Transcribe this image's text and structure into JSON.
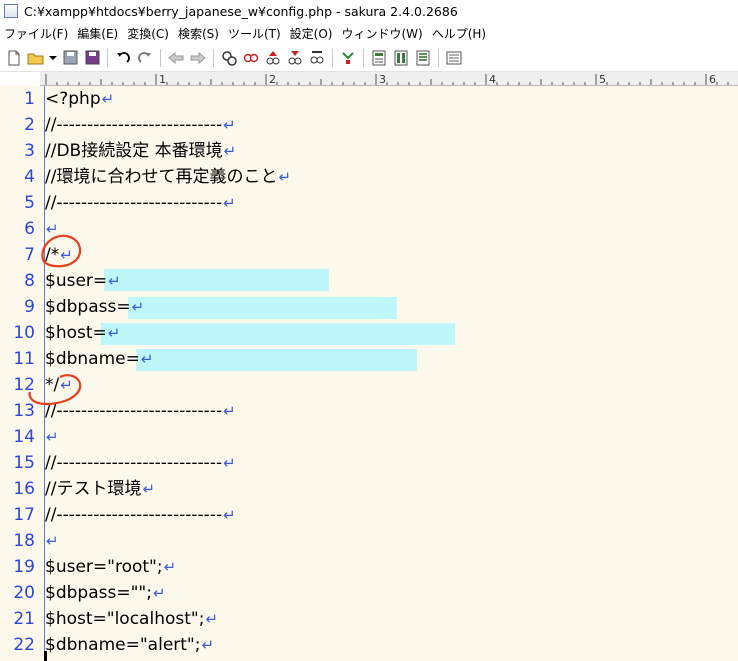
{
  "window": {
    "title": "C:¥xampp¥htdocs¥berry_japanese_w¥config.php - sakura 2.4.0.2686"
  },
  "menu": [
    "ファイル(F)",
    "編集(E)",
    "変換(C)",
    "検索(S)",
    "ツール(T)",
    "設定(O)",
    "ウィンドウ(W)",
    "ヘルプ(H)"
  ],
  "ruler": {
    "labels": [
      "1",
      "2",
      "3",
      "4",
      "5",
      "6"
    ]
  },
  "newline_glyph": "↵",
  "lines": [
    {
      "n": "1",
      "text": "<?php"
    },
    {
      "n": "2",
      "text": "//---------------------------"
    },
    {
      "n": "3",
      "text": "//DB接続設定 本番環境"
    },
    {
      "n": "4",
      "text": "//環境に合わせて再定義のこと"
    },
    {
      "n": "5",
      "text": "//---------------------------"
    },
    {
      "n": "6",
      "text": ""
    },
    {
      "n": "7",
      "text": "/*"
    },
    {
      "n": "8",
      "text": "$user="
    },
    {
      "n": "9",
      "text": "$dbpass="
    },
    {
      "n": "10",
      "text": "$host="
    },
    {
      "n": "11",
      "text": "$dbname="
    },
    {
      "n": "12",
      "text": "*/"
    },
    {
      "n": "13",
      "text": "//---------------------------"
    },
    {
      "n": "14",
      "text": ""
    },
    {
      "n": "15",
      "text": "//---------------------------"
    },
    {
      "n": "16",
      "text": "//テスト環境"
    },
    {
      "n": "17",
      "text": "//---------------------------"
    },
    {
      "n": "18",
      "text": ""
    },
    {
      "n": "19",
      "text": "$user=\"root\";"
    },
    {
      "n": "20",
      "text": "$dbpass=\"\";"
    },
    {
      "n": "21",
      "text": "$host=\"localhost\";"
    },
    {
      "n": "22",
      "text": "$dbname=\"alert\";"
    }
  ],
  "colors": {
    "background": "#fdf8ec",
    "line_number": "#2b46d8",
    "newline": "#3b5cd8",
    "redaction": "#bdf7fb",
    "annotation": "#e8401c"
  },
  "icons": [
    "new-file-icon",
    "open-folder-icon",
    "dropdown-arrow-icon",
    "save-icon",
    "save-all-icon",
    "undo-icon",
    "redo-icon",
    "back-jump-icon",
    "forward-jump-icon",
    "grep-icon",
    "find-icon",
    "find-prev-icon",
    "find-next-icon",
    "replace-icon",
    "compare-icon",
    "outline-icon",
    "macro-icon",
    "settings-icon",
    "window-list-icon"
  ]
}
